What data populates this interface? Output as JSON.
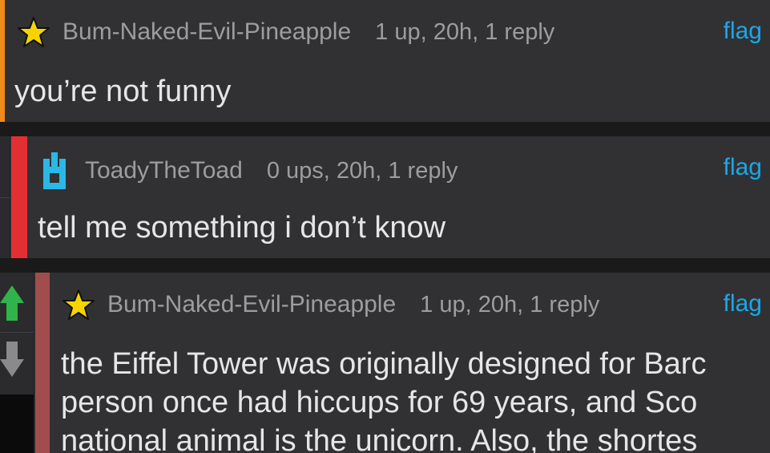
{
  "comments": [
    {
      "avatar_icon": "star-icon",
      "username": "Bum-Naked-Evil-Pineapple",
      "stats": "1 up, 20h, 1 reply",
      "flag_label": "flag",
      "body": "you’re not funny",
      "accent_color": "#f08a1a"
    },
    {
      "avatar_icon": "pixel-character-icon",
      "username": "ToadyTheToad",
      "stats": "0 ups, 20h, 1 reply",
      "flag_label": "flag",
      "body": "tell me something i don’t know",
      "accent_color": "#e32f34"
    },
    {
      "avatar_icon": "star-icon",
      "username": "Bum-Naked-Evil-Pineapple",
      "stats": "1 up, 20h, 1 reply",
      "flag_label": "flag",
      "body_lines": [
        "the Eiffel Tower was originally designed for Barc",
        "person once had hiccups for 69 years, and Sco",
        "national animal is the unicorn. Also, the shortes"
      ],
      "accent_color": "#a14d4d"
    }
  ],
  "vote_controls": {
    "upvote_icon": "upvote-arrow-icon",
    "downvote_icon": "downvote-arrow-icon",
    "upvote_color": "#2fb34a",
    "downvote_color": "#8a8a8c"
  },
  "colors": {
    "background": "#1a1a1a",
    "card": "#313133",
    "link": "#1ba7e8",
    "star": "#f5d400"
  }
}
